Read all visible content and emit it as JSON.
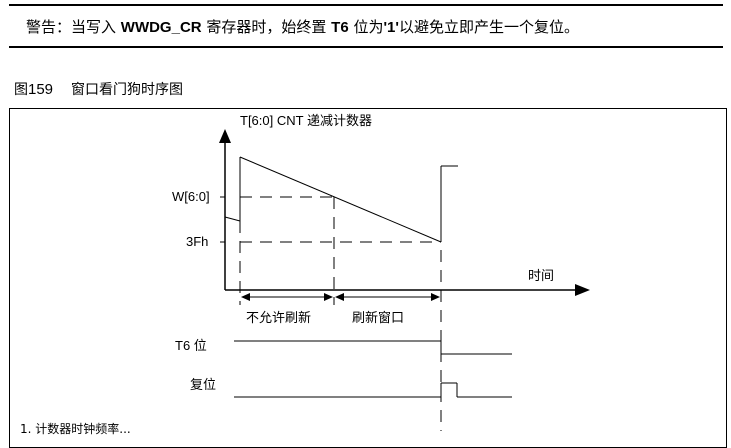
{
  "warning": {
    "prefix": "警告：当写入 ",
    "register": "WWDG_CR",
    "middle1": " 寄存器时，始终置 ",
    "bit": "T6",
    "middle2": " 位为",
    "value": "'1'",
    "suffix": "以避免立即产生一个复位。"
  },
  "figure": {
    "number_prefix": "图",
    "number": "159",
    "title": "窗口看门狗时序图"
  },
  "diagram": {
    "y_axis_label": "T[6:0] CNT 递减计数器",
    "x_axis_label": "时间",
    "level_w": "W[6:0]",
    "level_3fh": "3Fh",
    "region_not_allowed": "不允许刷新",
    "region_refresh_window": "刷新窗口",
    "signal_t6": "T6 位",
    "signal_reset": "复位"
  },
  "footnote": "1. 计数器时钟频率..."
}
